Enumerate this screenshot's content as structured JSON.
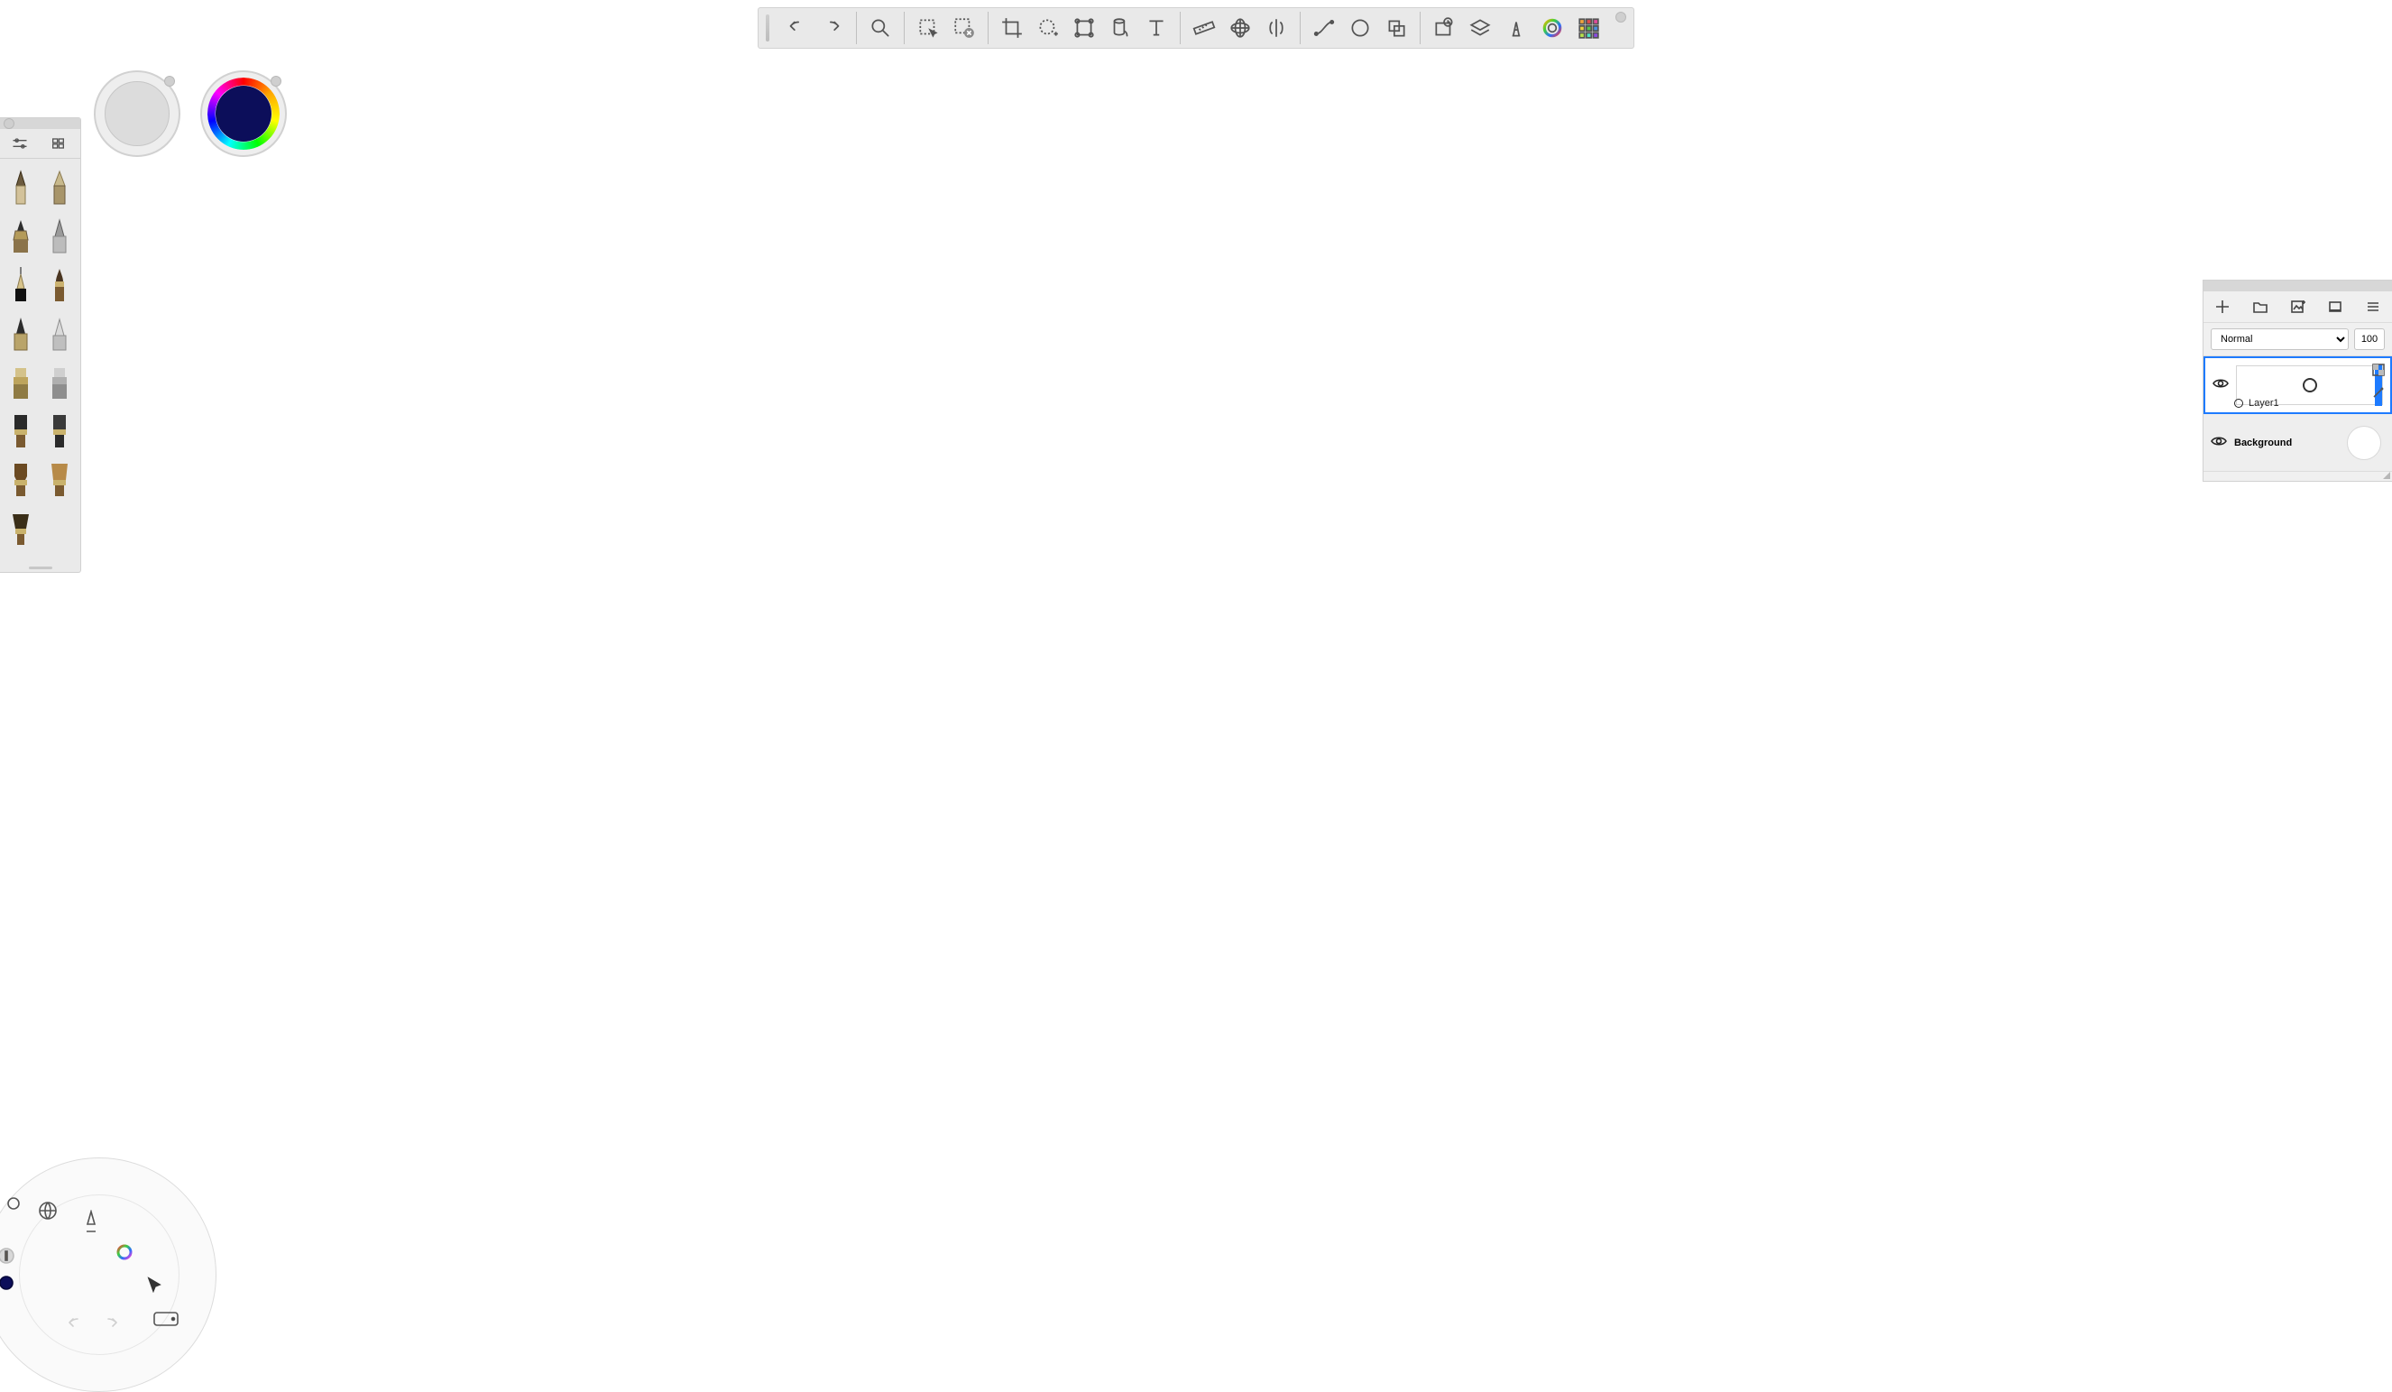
{
  "toolbar": {
    "groups": [
      [
        "undo",
        "redo"
      ],
      [
        "zoom"
      ],
      [
        "select-rect",
        "select-clear"
      ],
      [
        "crop",
        "select-add",
        "transform",
        "fill",
        "text"
      ],
      [
        "ruler",
        "perspective",
        "symmetry"
      ],
      [
        "curve",
        "ellipse",
        "shape"
      ],
      [
        "time-lapse",
        "layers-toggle",
        "brush-editor",
        "color-wheel",
        "copic"
      ]
    ]
  },
  "pucks": {
    "bg_color": "#dcdcdc",
    "fg_color": "#0c0e5a"
  },
  "brush_palette": {
    "tabs": [
      "sliders",
      "grid"
    ],
    "brushes": [
      {
        "name": "pencil-soft"
      },
      {
        "name": "pencil-hard"
      },
      {
        "name": "technical-pen"
      },
      {
        "name": "conte"
      },
      {
        "name": "inking-pen"
      },
      {
        "name": "round-brush"
      },
      {
        "name": "chisel"
      },
      {
        "name": "airbrush"
      },
      {
        "name": "marker-square"
      },
      {
        "name": "marker-round"
      },
      {
        "name": "paint-flat"
      },
      {
        "name": "paint-round"
      },
      {
        "name": "bristle-hard"
      },
      {
        "name": "bristle-soft"
      },
      {
        "name": "smudge"
      }
    ]
  },
  "layers_panel": {
    "actions": [
      "add",
      "folder",
      "image",
      "bg",
      "menu"
    ],
    "blend_mode_label": "Normal",
    "opacity_value": "100",
    "layers": [
      {
        "name_label": "Layer1",
        "visible": true,
        "selected": true
      },
      {
        "name_label": "Background",
        "visible": true,
        "selected": false,
        "is_bg": true
      }
    ]
  },
  "lagoon": {
    "current_color": "#0c0e5a"
  }
}
